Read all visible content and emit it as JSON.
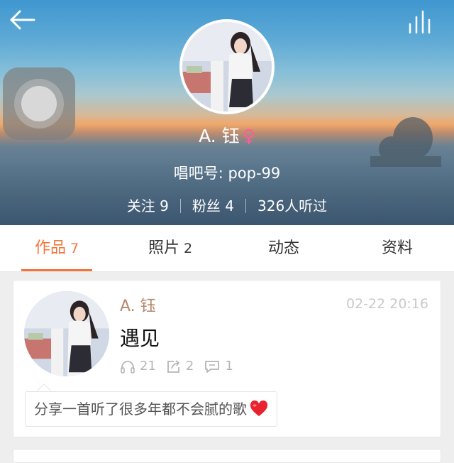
{
  "profile": {
    "name": "A. 钰",
    "gender_symbol": "♀",
    "id_text": "唱吧号: pop-99",
    "stats": {
      "following": "关注 9",
      "fans": "粉丝 4",
      "listeners": "326人听过"
    }
  },
  "tabs": [
    {
      "label": "作品",
      "count": "7",
      "active": true
    },
    {
      "label": "照片",
      "count": "2",
      "active": false
    },
    {
      "label": "动态",
      "count": "",
      "active": false
    },
    {
      "label": "资料",
      "count": "",
      "active": false
    }
  ],
  "post": {
    "author": "A. 钰",
    "time": "02-22 20:16",
    "title": "遇见",
    "plays": "21",
    "shares": "2",
    "comments": "1",
    "share_text": "分享一首听了很多年都不会腻的歌"
  },
  "colors": {
    "accent": "#f3753c",
    "author": "#b8866a",
    "gender": "#ff5c9a"
  },
  "icons": {
    "back": "back-arrow-icon",
    "equalizer": "equalizer-icon",
    "headphones": "headphones-icon",
    "share": "share-icon",
    "comment": "comment-icon",
    "heart": "heart-icon"
  }
}
